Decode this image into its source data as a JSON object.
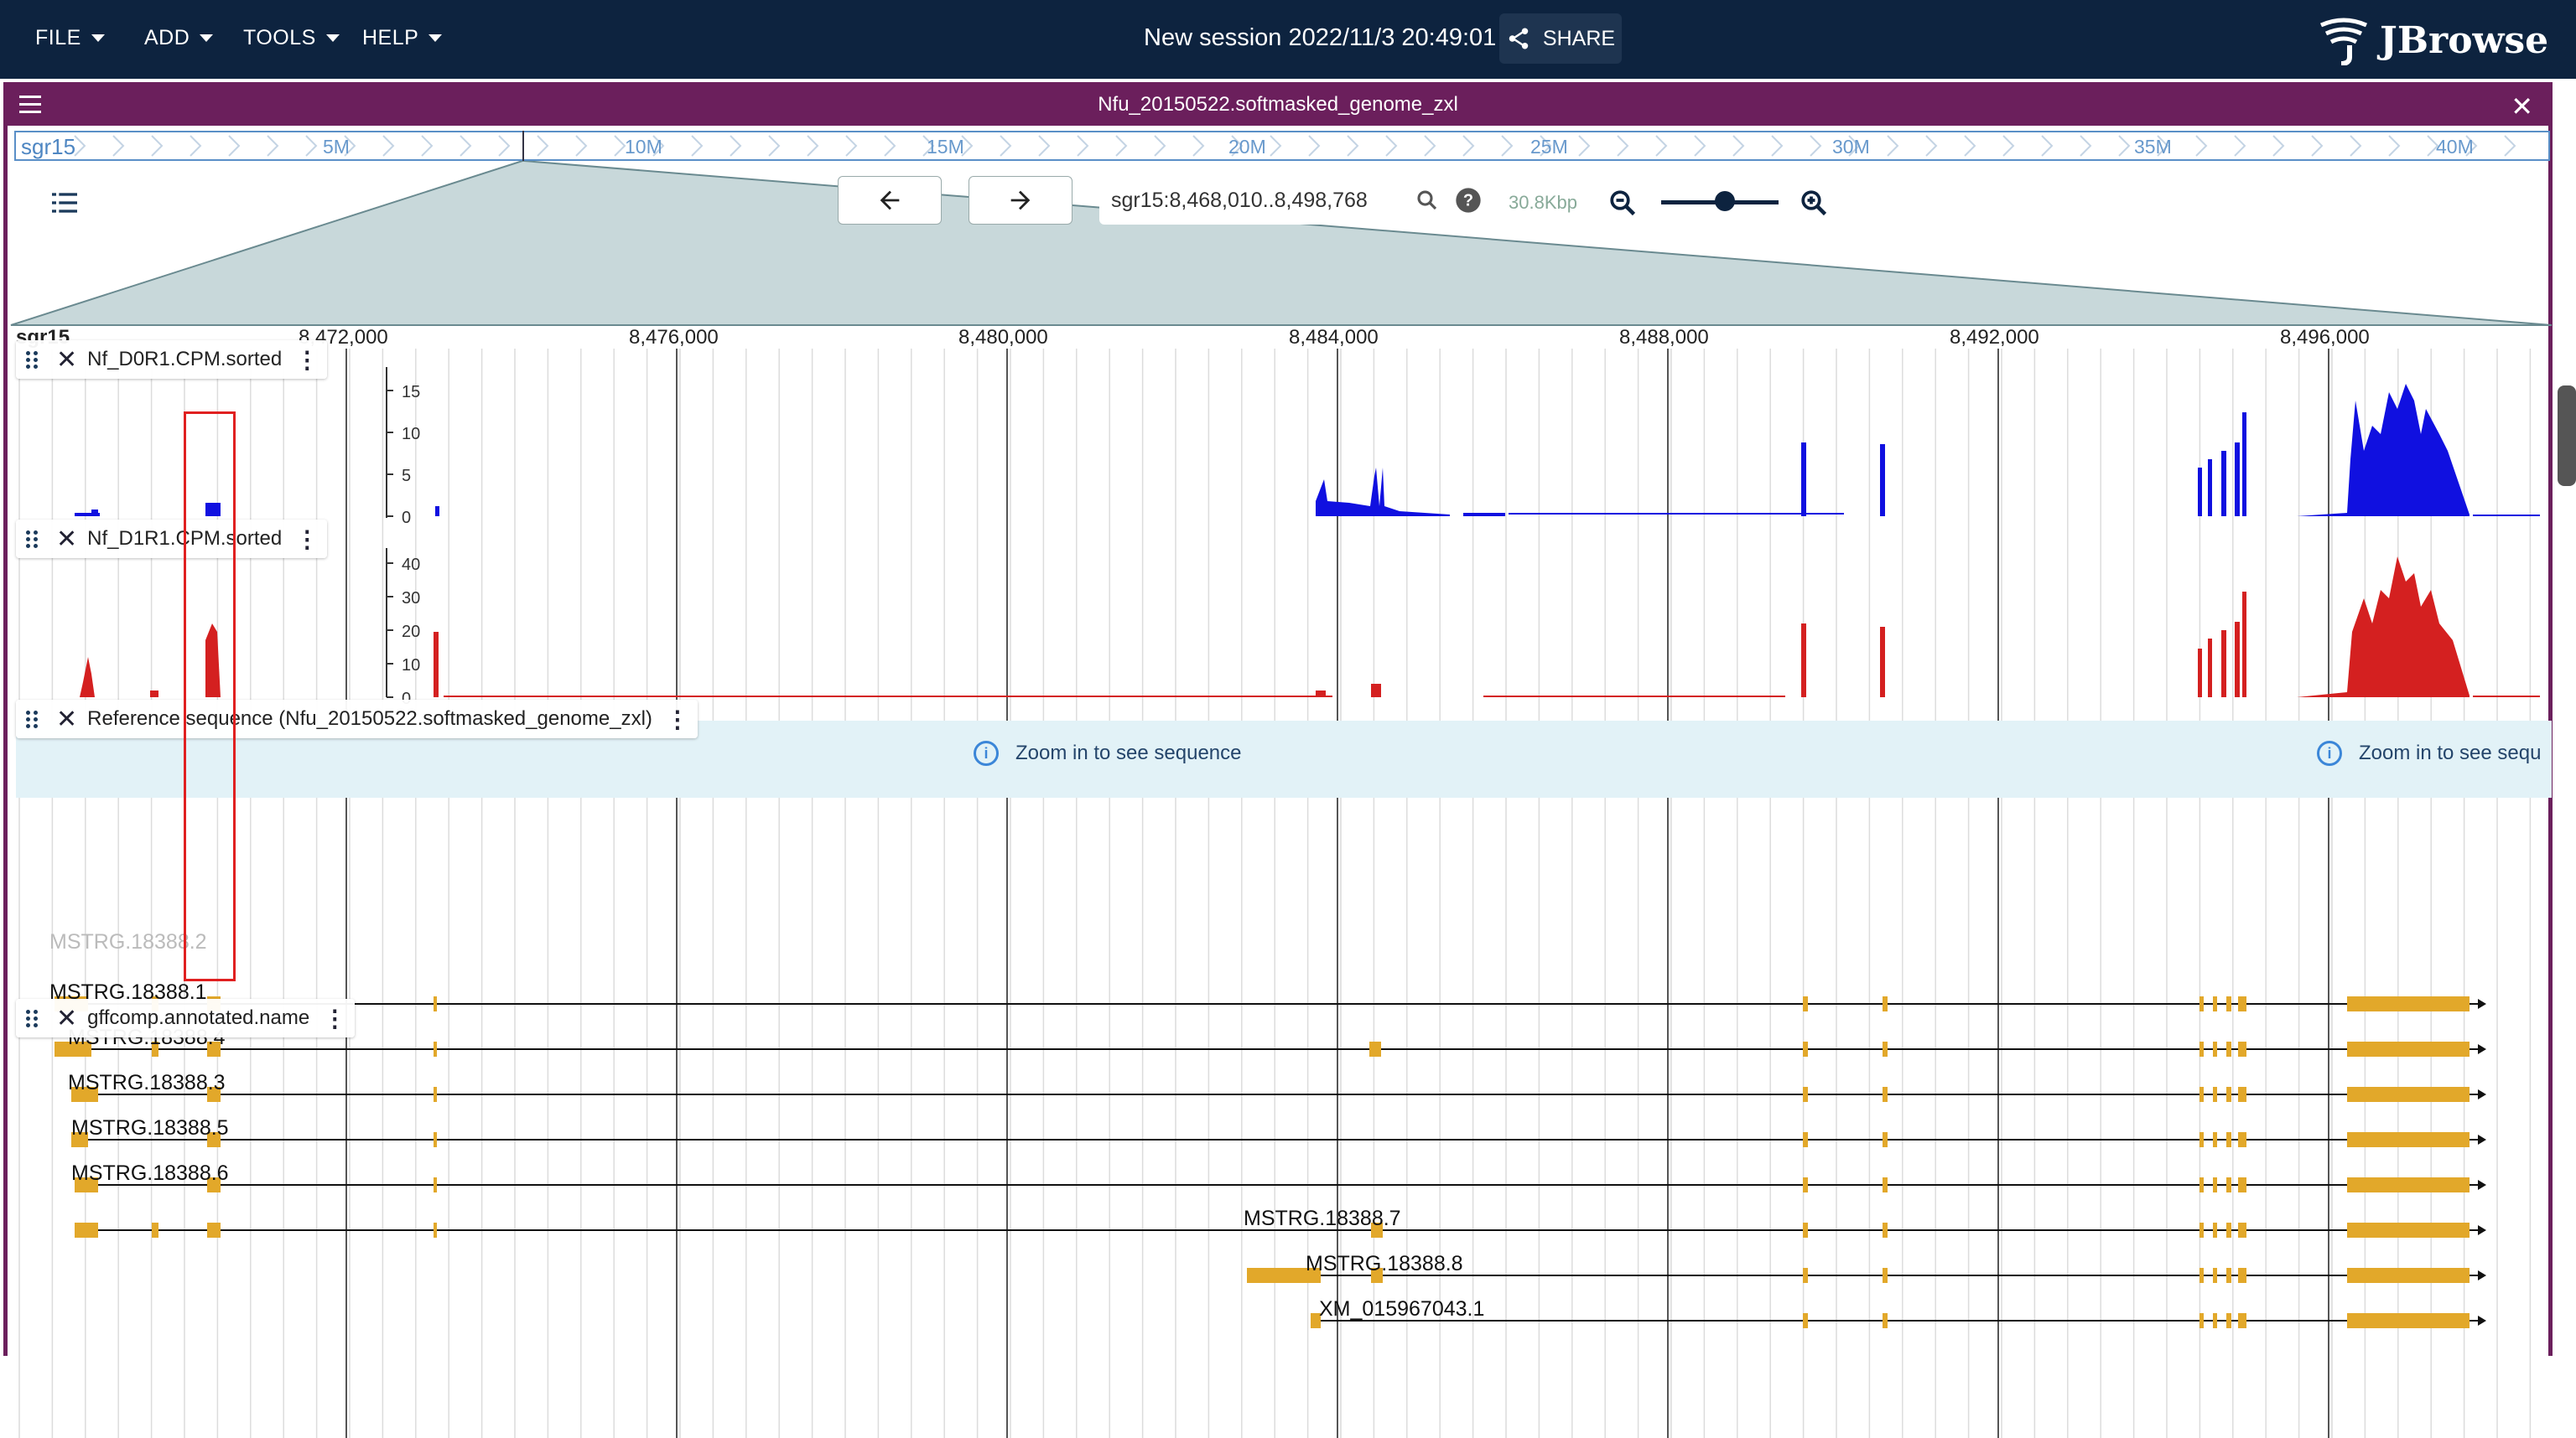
{
  "menu": {
    "file": "FILE",
    "add": "ADD",
    "tools": "TOOLS",
    "help": "HELP"
  },
  "session": {
    "title": "New session 2022/11/3 20:49:01",
    "share": "SHARE"
  },
  "logo": {
    "text": "JBrowse"
  },
  "view": {
    "title": "Nfu_20150522.softmasked_genome_zxl"
  },
  "overview": {
    "label": "sgr15",
    "ticks": [
      "5M",
      "10M",
      "15M",
      "20M",
      "25M",
      "30M",
      "35M",
      "40M"
    ]
  },
  "navigation": {
    "locstring": "sgr15:8,468,010..8,498,768",
    "bp_per_view": "30.8Kbp"
  },
  "ruler": {
    "chromosome": "sgr15",
    "ticks": [
      "8,472,000",
      "8,476,000",
      "8,480,000",
      "8,484,000",
      "8,488,000",
      "8,492,000",
      "8,496,000"
    ]
  },
  "tracks": {
    "track1": {
      "name": "Nf_D0R1.CPM.sorted",
      "scale": [
        "15",
        "10",
        "5",
        "0"
      ],
      "color": "#1010e0"
    },
    "track2": {
      "name": "Nf_D1R1.CPM.sorted",
      "scale": [
        "40",
        "30",
        "20",
        "10",
        "0"
      ],
      "color": "#d42020"
    },
    "reference": {
      "name": "Reference sequence (Nfu_20150522.softmasked_genome_zxl)",
      "message": "Zoom in to see sequence",
      "message_clipped": "Zoom in to see sequ"
    },
    "annotation": {
      "name": "gffcomp.annotated.name",
      "feature_color": "#e2a82a",
      "features": [
        "MSTRG.18388.2",
        "MSTRG.18388.1",
        "MSTRG.18388.4",
        "MSTRG.18388.3",
        "MSTRG.18388.5",
        "MSTRG.18388.6",
        "MSTRG.18388.7",
        "MSTRG.18388.8",
        "XM_015967043.1"
      ]
    }
  },
  "icons": {
    "caret": "caret-down-icon",
    "share": "share-icon",
    "hamburger": "menu-icon",
    "close": "close-icon",
    "back": "arrow-left-icon",
    "forward": "arrow-right-icon",
    "search": "search-icon",
    "help": "help-icon",
    "zoom_out": "zoom-out-icon",
    "zoom_in": "zoom-in-icon",
    "drag": "drag-handle-icon",
    "kebab": "more-vert-icon",
    "info": "info-icon"
  }
}
